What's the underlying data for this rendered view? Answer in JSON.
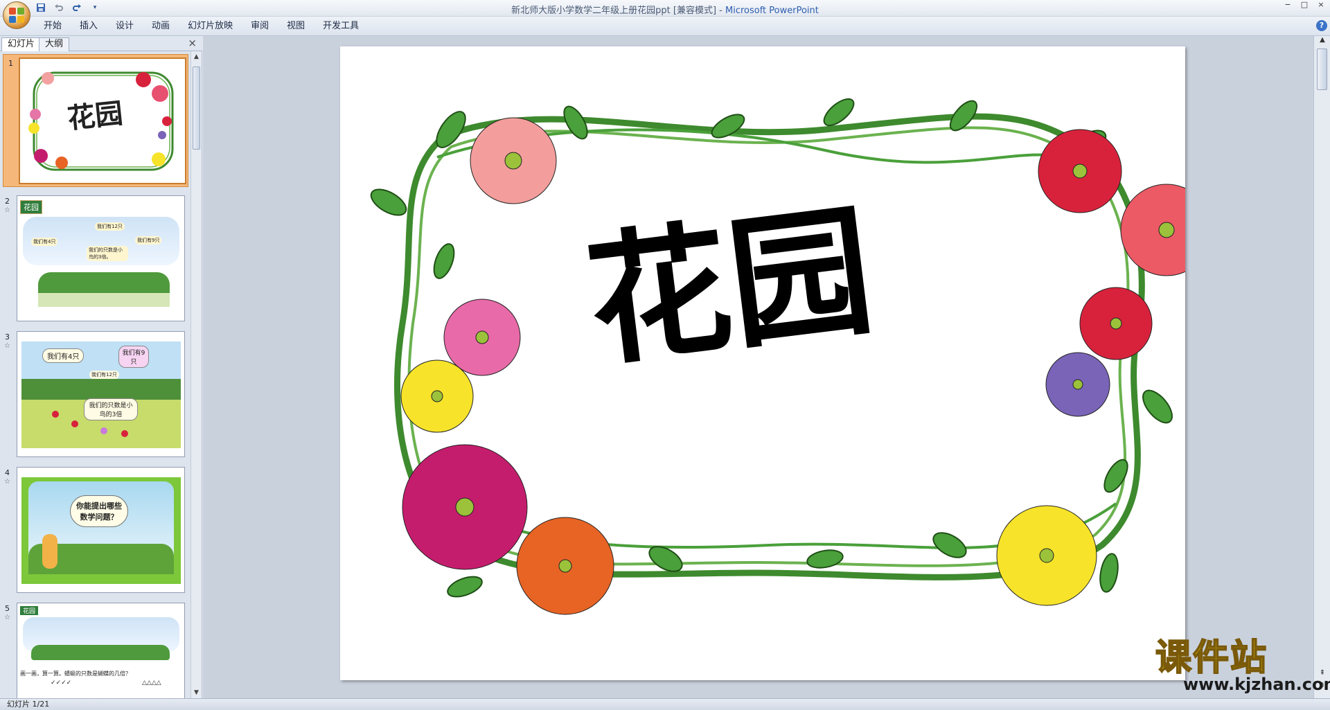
{
  "window": {
    "title_doc": "新北师大版小学数学二年级上册花园ppt [兼容模式] - ",
    "title_app": "Microsoft PowerPoint",
    "controls": [
      "−",
      "□",
      "×"
    ]
  },
  "quick_access": {
    "save_icon": "save-icon",
    "undo_icon": "undo-icon",
    "redo_icon": "redo-icon",
    "customize": "▾"
  },
  "ribbon": {
    "tabs": [
      "开始",
      "插入",
      "设计",
      "动画",
      "幻灯片放映",
      "审阅",
      "视图",
      "开发工具"
    ],
    "help": "?"
  },
  "slides_panel": {
    "tabs": [
      "幻灯片",
      "大纲"
    ],
    "active_tab": "幻灯片",
    "close": "×",
    "items": [
      {
        "number": "1",
        "title": "花园",
        "selected": true
      },
      {
        "number": "2",
        "badge": "花园",
        "speech": [
          "我们有12只",
          "我们有4只",
          "我们的只数是小鸟的3倍。",
          "我们有9只"
        ]
      },
      {
        "number": "3",
        "speech": [
          "我们有4只",
          "我们有9只",
          "我们有12只",
          "我们的只数是小鸟的3倍"
        ]
      },
      {
        "number": "4",
        "speech": [
          "你能提出哪些数学问题？"
        ]
      },
      {
        "number": "5",
        "badge": "花园",
        "caption": "画一画，算一算。蜻蜓的只数是蝴蝶的几倍？",
        "marks": [
          "✓✓✓✓",
          "△△△△"
        ]
      }
    ]
  },
  "slide": {
    "title": "花园",
    "colors": {
      "vine": "#3e8a2e",
      "leaf": "#4aa03a",
      "leaf_dark": "#2d6e22"
    }
  },
  "status": {
    "text": "幻灯片 1/21"
  },
  "watermark": {
    "cn": "课件站",
    "url": "www.kjzhan.com"
  }
}
